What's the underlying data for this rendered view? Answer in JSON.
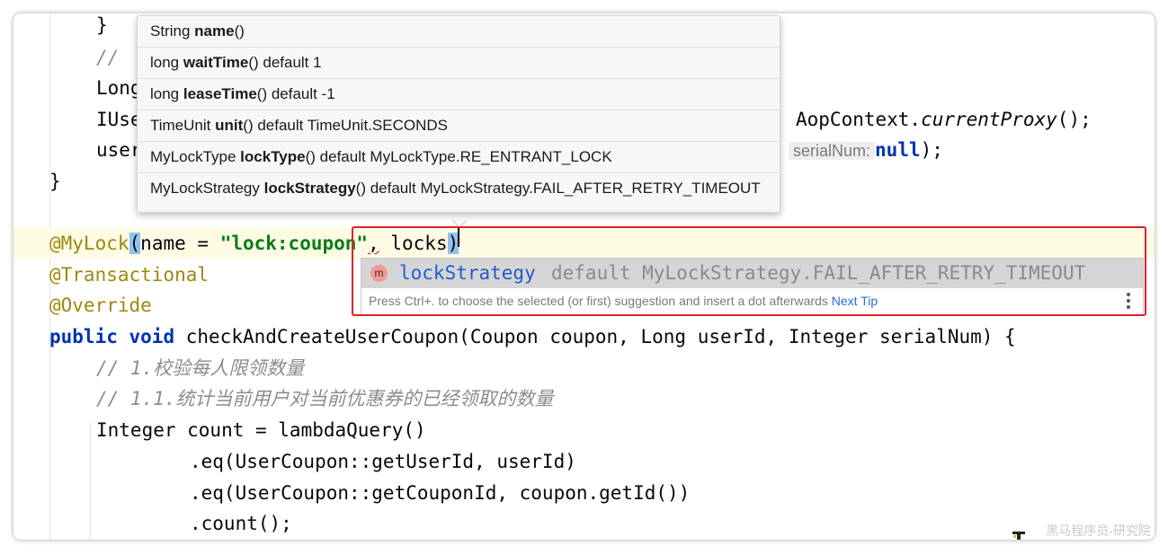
{
  "editor": {
    "lines": [
      {
        "id": "brace1",
        "text": "}"
      },
      {
        "id": "cmt-partial",
        "text": "// "
      },
      {
        "id": "long-partial",
        "text": "Long"
      },
      {
        "id": "iuse-partial",
        "text": "IUse",
        "tail": "AopContext.",
        "tail_ital": "currentProxy",
        "tail_end": "();"
      },
      {
        "id": "user-partial",
        "text": "user",
        "hint": "serialNum:",
        "kw": "null",
        "end": ");"
      },
      {
        "id": "brace2",
        "text": "}"
      }
    ],
    "annotation_line": {
      "ann": "@MyLock",
      "open": "(",
      "param": "name = ",
      "str": "\"lock:coupon\"",
      "comma": ",",
      "typed": "locks",
      "close": ")"
    },
    "transactional": "@Transactional",
    "override": "@Override",
    "method_sig": {
      "kw1": "public",
      "kw2": "void",
      "rest": "checkAndCreateUserCoupon(Coupon coupon, Long userId, Integer serialNum) {"
    },
    "comment1": "// 1.校验每人限领数量",
    "comment2": "// 1.1.统计当前用户对当前优惠券的已经领取的数量",
    "line_count1": "Integer count = lambdaQuery()",
    "line_eq1": ".eq(UserCoupon::getUserId, userId)",
    "line_eq2": ".eq(UserCoupon::getCouponId, coupon.getId())",
    "line_count2": ".count();"
  },
  "param_info": [
    {
      "type": "String",
      "name": "name",
      "suffix": "()"
    },
    {
      "type": "long",
      "name": "waitTime",
      "suffix": "() default 1"
    },
    {
      "type": "long",
      "name": "leaseTime",
      "suffix": "() default -1"
    },
    {
      "type": "TimeUnit",
      "name": "unit",
      "suffix": "() default TimeUnit.SECONDS"
    },
    {
      "type": "MyLockType",
      "name": "lockType",
      "suffix": "() default MyLockType.RE_ENTRANT_LOCK"
    },
    {
      "type": "MyLockStrategy",
      "name": "lockStrategy",
      "suffix": "() default MyLockStrategy.FAIL_AFTER_RETRY_TIMEOUT"
    }
  ],
  "completion": {
    "icon_letter": "m",
    "match": "lockS",
    "rest": "trategy",
    "detail": "default MyLockStrategy.FAIL_AFTER_RETRY_TIMEOUT",
    "footer": "Press Ctrl+. to choose the selected (or first) suggestion and insert a dot afterwards",
    "next_tip": "Next Tip"
  },
  "watermark": "黑马程序员-研究院",
  "colors": {
    "keyword": "#0033b3",
    "annotation": "#9e880d",
    "string": "#067d17",
    "comment": "#8c8c8c",
    "highlight_box": "#e0212b"
  }
}
